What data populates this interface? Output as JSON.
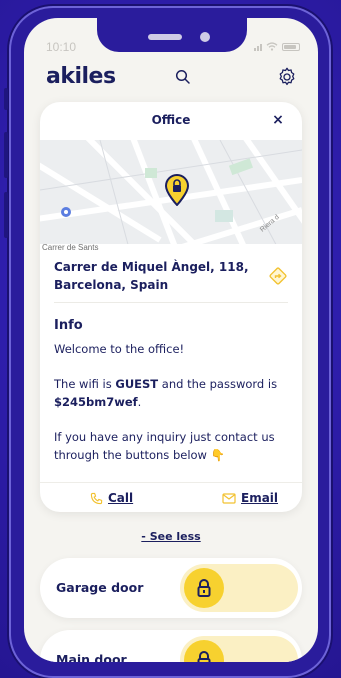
{
  "status_bar": {
    "time": "10:10"
  },
  "app": {
    "logo": "akiles",
    "search_icon": "search-icon",
    "settings_icon": "gear-icon"
  },
  "card": {
    "title": "Office",
    "close_label": "×",
    "map": {
      "street_label": "Carrer de Sants"
    },
    "address": "Carrer de Miquel Àngel, 118, Barcelona, Spain",
    "info_title": "Info",
    "info_p1": "Welcome to the office!",
    "info_p2_a": "The wifi is ",
    "info_p2_wifi": "GUEST",
    "info_p2_b": " and the password is ",
    "info_p2_password": "$245bm7wef",
    "info_p2_c": ".",
    "info_p3": "If you have any inquiry just contact us through the buttons below 👇",
    "call_label": "Call",
    "email_label": "Email"
  },
  "see_less_label": "- See less",
  "doors": [
    {
      "name": "Garage door"
    },
    {
      "name": "Main door"
    }
  ],
  "colors": {
    "navy": "#1b1f5e",
    "yellow": "#f7d12f",
    "background": "#2f1fa8",
    "screen": "#f5f4f0"
  }
}
